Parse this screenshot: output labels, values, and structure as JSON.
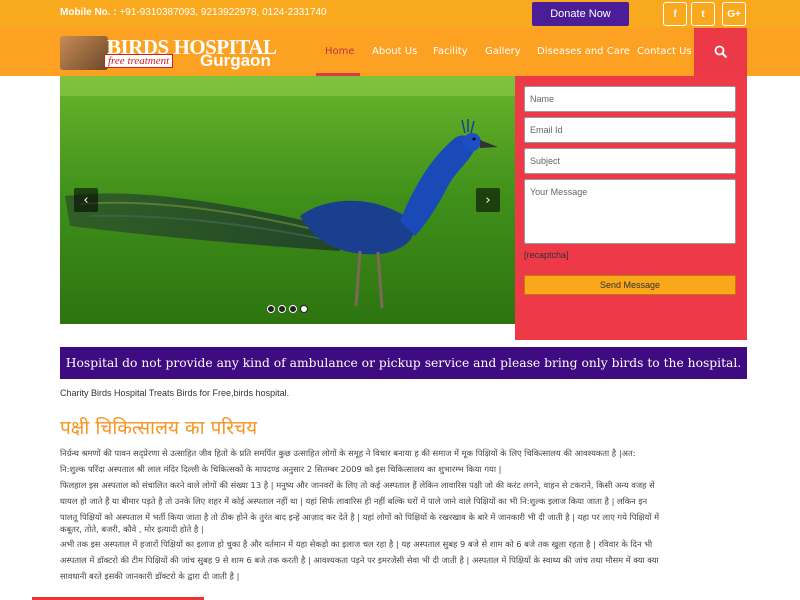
{
  "topbar": {
    "mobile_label": "Mobile No. :",
    "mobile_numbers": "+91-9310387093, 9213922978, 0124-2331740",
    "donate_label": "Donate Now",
    "social": [
      {
        "icon": "facebook-icon",
        "glyph": "f"
      },
      {
        "icon": "twitter-icon",
        "glyph": "t"
      },
      {
        "icon": "google-plus-icon",
        "glyph": "G+"
      }
    ]
  },
  "logo": {
    "line1": "BIRDS HOSPITAL",
    "line2": "free treatment",
    "line3": "Gurgaon"
  },
  "nav": {
    "items": [
      "Home",
      "About Us",
      "Facility",
      "Gallery",
      "Diseases and Care",
      "Contact Us"
    ],
    "active": "Home",
    "search_icon": "search-icon"
  },
  "slider": {
    "prev_icon": "chevron-left-icon",
    "next_icon": "chevron-right-icon",
    "slide_count": 4,
    "active_slide": 4
  },
  "form": {
    "name_placeholder": "Name",
    "email_placeholder": "Email Id",
    "subject_placeholder": "Subject",
    "message_placeholder": "Your Message",
    "recaptcha": "[recaptcha]",
    "send_label": "Send Message"
  },
  "notice": "Hospital do not provide any kind of ambulance or pickup service and please bring only birds to the hospital.",
  "tagline": "Charity Birds Hospital Treats Birds for Free,birds hospital.",
  "intro": {
    "heading": "पक्षी चिकित्सालय का परिचय",
    "lines": [
      "निर्ग्रन्थ श्रमणों की पावन सद्प्रेरणा से उत्साहित जीव हितो के प्रति समर्पित कुछ उत्साहित लोगों के समूह ने विचार बनाया ह की समाज में मूक पिक्षियों के लिए चिकित्सालय की आवश्यकता है |अत:",
      "नि:शुल्क परिंदा अस्पताल श्री लाल मंदिर दिल्ली के चिकित्सकों के मापदण्ड अनुसार 2 सितम्बर 2009 को इस चिकित्सालय का शुभारम्भ किया गया |",
      "फिलहाल इस अस्पताल को संचालित करने वाले लोगों की संख्या 13 है | मनुष्य और जानवरों के लिए तो कई अस्पताल हैं लेकिन लावारिस पक्षी जो की करंट लगने, वाहन से टकराने, किसी अन्य वजह से",
      "घायल हो जाते हैं या बीमार पड़ते है तो उनके लिए शहर में कोई अस्पताल नहीं था | यहां सिर्फ लावारिस ही नहीं बल्कि घरों में पाले जाने वाले पिक्षियों का भी नि:शुल्क इलाज किया जाता है | लकिन इन",
      "पालतू पिक्षियों को अस्पताल में भर्ती किया जाता है तो ठीक होने के तुरंत बाद इन्हें आज़ाद कर देते है | यहां लोगों को पिक्षियों के रखरखाव के बारे में जानकारी भी दी जाती है | यहा पर लाए गये पिक्षियों में",
      "कबूतर, तोते, बजरी, कौवे , मोर इत्यादी होते है |",
      "अभी तक इस अस्पताल में हजारों पिक्षियों का इलाज हो चुका है और वर्तमान में यहा सेकड़ो का इलाज चल रहा है | यह अस्पताल सुबह 9 बजे से शाम को 6 बजे तक खुला रहता है | रविवार के दिन भी",
      "अस्पताल में डॉक्टरो की टीम पिक्षियों की जांच सुबह 9 से शाम 6 बजे तक करती है | आवश्यकता पड़ने पर इमरजेंसी सेवा भी दी जाती है | अस्पताल में पिक्षियों के स्वाथ्य की जांच तथा मौसम में क्या क्या",
      "सावधानी बरते इसकी जानकारी डॉक्टरो के द्वारा दी जाती है |"
    ]
  },
  "colors": {
    "topbar": "#f9a91e",
    "navbar": "#fca121",
    "accent_red": "#ed3948",
    "purple": "#3e0b80",
    "donate": "#4b1d96",
    "heading_orange": "#f7931e"
  }
}
